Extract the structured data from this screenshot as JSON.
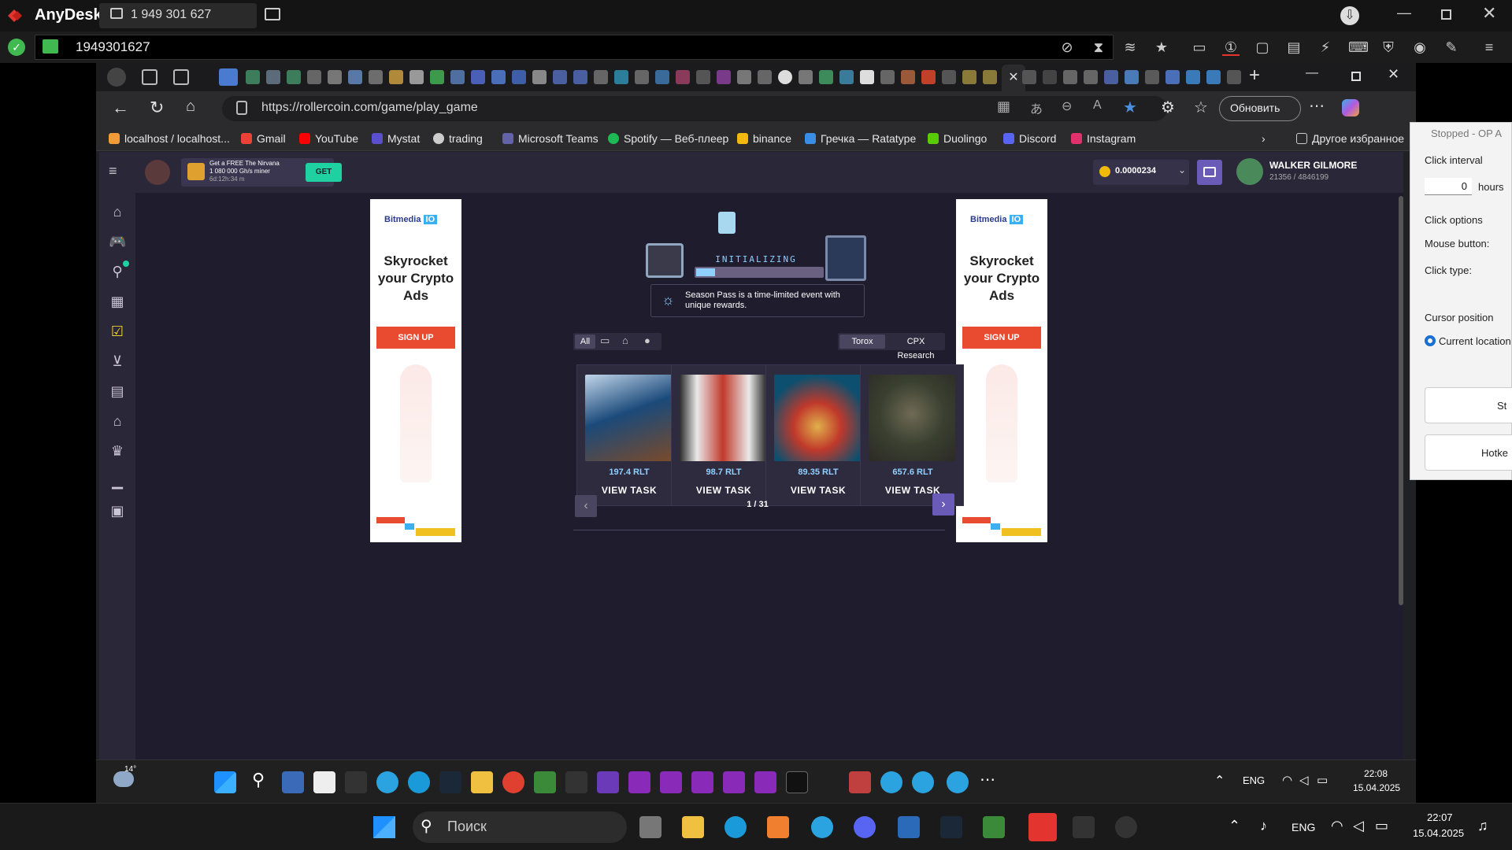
{
  "anydesk": {
    "brand": "AnyDesk",
    "session_tab": "1 949 301 627",
    "address": "1949301627"
  },
  "browser": {
    "url": "https://rollercoin.com/game/play_game",
    "update_button": "Обновить",
    "bookmarks": [
      {
        "label": "localhost / localhost...",
        "color": "#f29b38"
      },
      {
        "label": "Gmail",
        "color": "#ea4335"
      },
      {
        "label": "YouTube",
        "color": "#ff0000"
      },
      {
        "label": "Mystat",
        "color": "#5a4fcf"
      },
      {
        "label": "trading",
        "color": "#cccccc"
      },
      {
        "label": "Microsoft Teams",
        "color": "#6264a7"
      },
      {
        "label": "Spotify — Веб-плеер",
        "color": "#1db954"
      },
      {
        "label": "binance",
        "color": "#f0b90b"
      },
      {
        "label": "Гречка — Ratatype",
        "color": "#3a8ee6"
      },
      {
        "label": "Duolingo",
        "color": "#58cc02"
      },
      {
        "label": "Discord",
        "color": "#5865f2"
      },
      {
        "label": "Instagram",
        "color": "#e1306c"
      }
    ],
    "other_bookmarks": "Другое избранное"
  },
  "site": {
    "promo_line1": "Get a FREE The Nirvana",
    "promo_line2": "1 080 000 Gh/s miner",
    "promo_timer": "6d:12h:34 m",
    "promo_button": "GET",
    "balance": "0.0000234",
    "username": "WALKER GILMORE",
    "user_stats": "21356 / 4846199",
    "status_text": "INITIALIZING",
    "tip": "Season Pass is a time-limited event with unique rewards.",
    "filters": [
      "All"
    ],
    "providers": [
      "Torox",
      "CPX Research"
    ],
    "games": [
      {
        "price": "197.4 RLT",
        "button": "VIEW TASK",
        "colors": [
          "#1b4a7a",
          "#c2d6ea",
          "#7a4a2a"
        ]
      },
      {
        "price": "98.7 RLT",
        "button": "VIEW TASK",
        "colors": [
          "#2b2b2b",
          "#c0392b",
          "#e9e9e9"
        ]
      },
      {
        "price": "89.35 RLT",
        "button": "VIEW TASK",
        "colors": [
          "#0d4f6e",
          "#c0392b",
          "#e0b04a"
        ]
      },
      {
        "price": "657.6 RLT",
        "button": "VIEW TASK",
        "colors": [
          "#3a4030",
          "#6f6a55",
          "#2c2a25"
        ]
      }
    ],
    "pagination": "1 / 31",
    "ad": {
      "brand": "Bitmedia",
      "brand_suffix": "IO",
      "title": "Skyrocket your Crypto Ads",
      "button": "SIGN UP"
    }
  },
  "clicker": {
    "title": "Stopped - OP A",
    "click_interval_label": "Click interval",
    "hours_value": "0",
    "hours_label": "hours",
    "click_options_label": "Click options",
    "mouse_button_label": "Mouse button:",
    "click_type_label": "Click type:",
    "cursor_position_label": "Cursor position",
    "current_location_label": "Current location",
    "start_button": "St",
    "hotkey_button": "Hotke"
  },
  "remote_taskbar": {
    "weather": "14°",
    "lang": "ENG",
    "time": "22:08",
    "date": "15.04.2025"
  },
  "local_taskbar": {
    "search_placeholder": "Поиск",
    "lang": "ENG",
    "time": "22:07",
    "date": "15.04.2025"
  }
}
